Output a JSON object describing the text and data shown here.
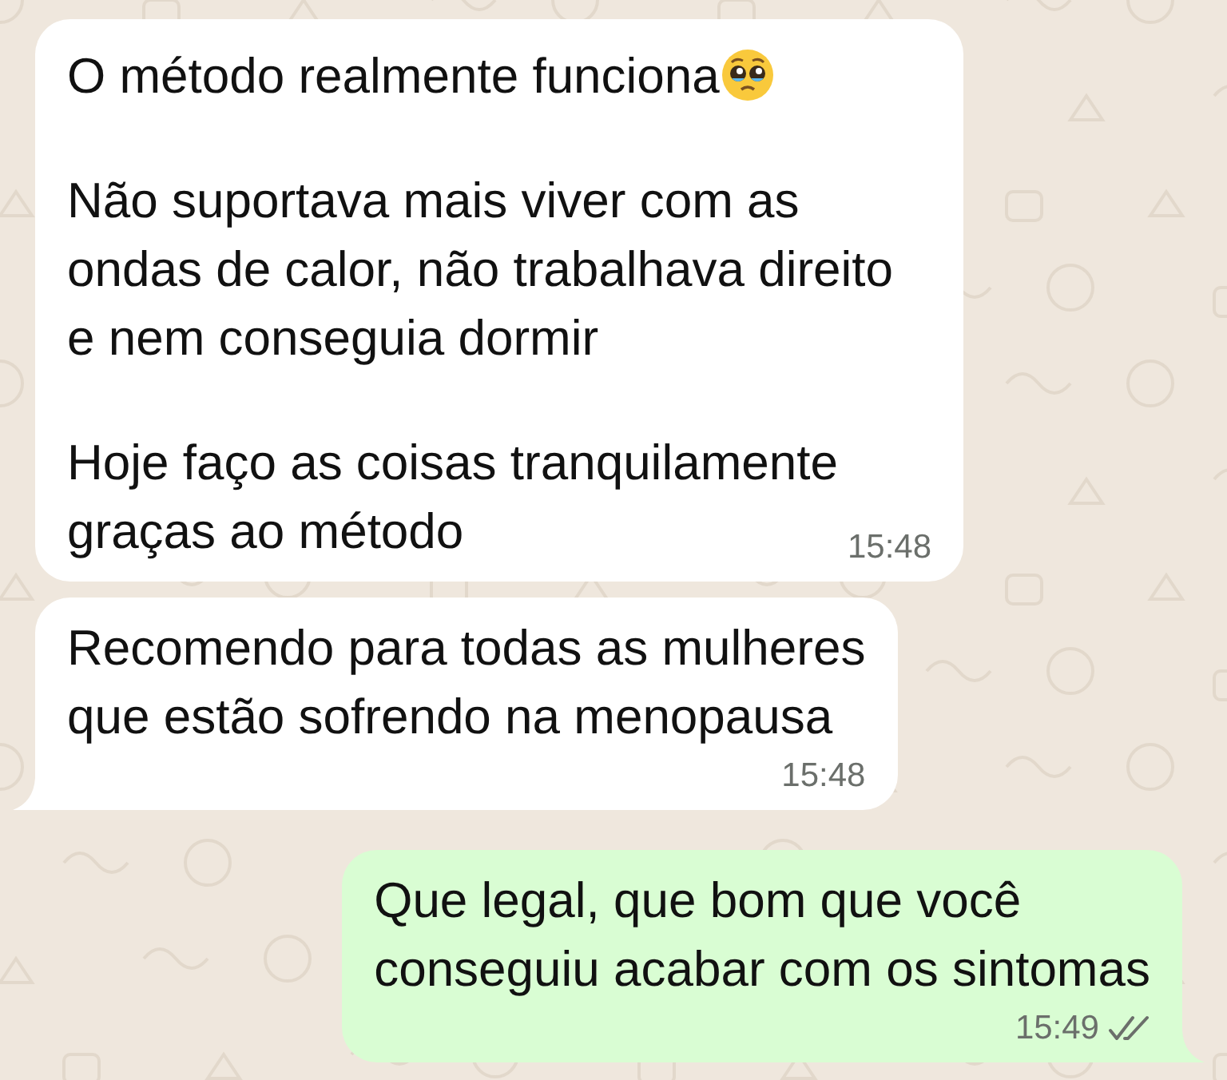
{
  "messages": [
    {
      "kind": "incoming",
      "tail": false,
      "paragraphs": [
        "O método realmente funciona",
        "Não suportava mais viver com as\nondas de calor, não trabalhava direito\ne nem conseguia dormir",
        "Hoje faço as coisas tranquilamente\ngraças ao método"
      ],
      "emoji_after_first": true,
      "time": "15:48"
    },
    {
      "kind": "incoming",
      "tail": true,
      "paragraphs": [
        "Recomendo para todas as mulheres\nque estão sofrendo na menopausa"
      ],
      "emoji_after_first": false,
      "time": "15:48"
    },
    {
      "kind": "outgoing",
      "tail": true,
      "paragraphs": [
        "Que legal, que bom que você\nconseguiu acabar com os sintomas"
      ],
      "emoji_after_first": false,
      "time": "15:49",
      "read": false
    }
  ]
}
